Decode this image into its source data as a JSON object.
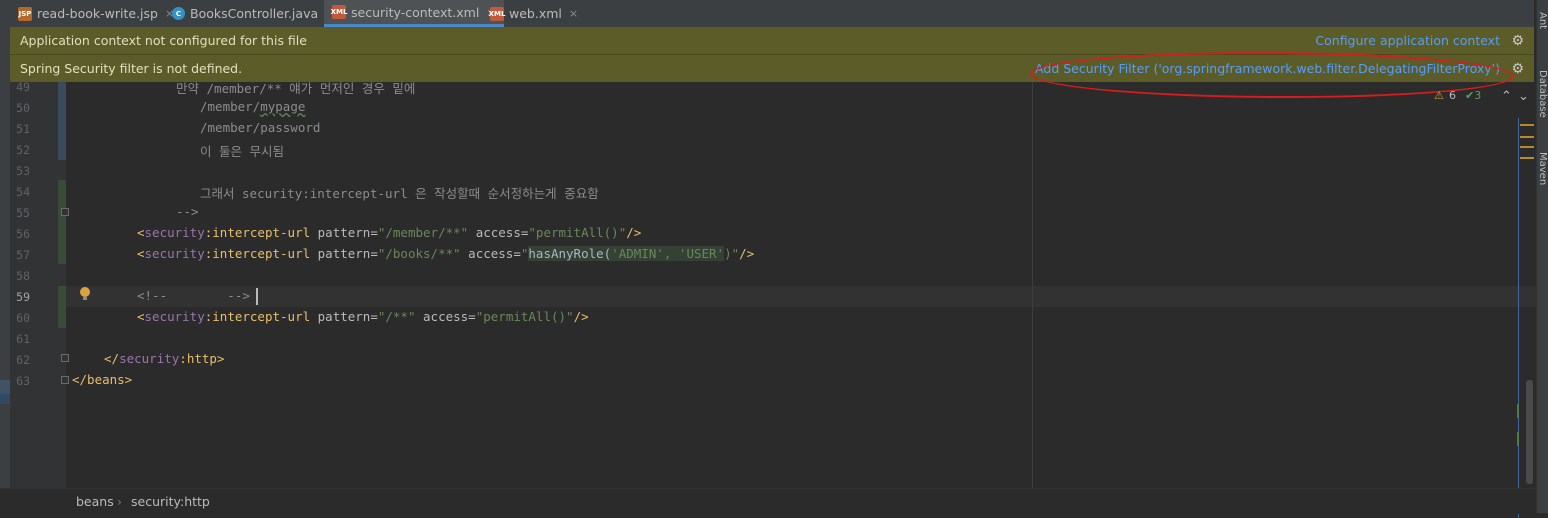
{
  "tabs": [
    {
      "label": "read-book-write.jsp",
      "icon": "jsp-file-icon",
      "icon_text": "JSP",
      "active": false
    },
    {
      "label": "BooksController.java",
      "icon": "java-class-icon",
      "icon_text": "C",
      "active": false
    },
    {
      "label": "security-context.xml",
      "icon": "xml-file-icon",
      "icon_text": "XML",
      "active": true
    },
    {
      "label": "web.xml",
      "icon": "xml-file-icon",
      "icon_text": "XML",
      "active": false
    }
  ],
  "close_glyph": "×",
  "right_tool_labels": [
    "Ant",
    "Database",
    "Maven"
  ],
  "banners": {
    "context": {
      "message": "Application context not configured for this file",
      "action": "Configure application context"
    },
    "security": {
      "message": "Spring Security filter is not defined.",
      "action": "Add Security Filter ('org.springframework.web.filter.DelegatingFilterProxy')"
    }
  },
  "inspections": {
    "warnings": "6",
    "checks": "3",
    "warning_glyph": "⚠",
    "check_glyph": "✔",
    "up": "⌃",
    "down": "⌄"
  },
  "lines": {
    "49": {
      "num": "49",
      "text": "만약 /member/** 얘가 먼저인 경우 밑에"
    },
    "50": {
      "num": "50",
      "text": "/member/",
      "spell": "mypage"
    },
    "51": {
      "num": "51",
      "text": "/member/password"
    },
    "52": {
      "num": "52",
      "text": "이 둘은 무시됨"
    },
    "53": {
      "num": "53"
    },
    "54": {
      "num": "54",
      "text": "그래서 security:intercept-url 은 작성할때 순서정하는게 중요함"
    },
    "55": {
      "num": "55",
      "text": "-->"
    },
    "56": {
      "num": "56",
      "pattern": "\"/member/**\"",
      "access": "\"permitAll()\""
    },
    "57": {
      "num": "57",
      "pattern": "\"/books/**\"",
      "access_q": "\"",
      "access_fn": "hasAnyRole(",
      "access_args": "'ADMIN', 'USER'",
      "access_end": ")\""
    },
    "58": {
      "num": "58"
    },
    "59": {
      "num": "59",
      "text": "<!--        -->"
    },
    "60": {
      "num": "60",
      "pattern": "\"/**\"",
      "access": "\"permitAll()\""
    },
    "61": {
      "num": "61"
    },
    "62": {
      "num": "62",
      "close": "</",
      "ns": "security",
      "colon": ":",
      "tag": "http",
      "end": ">"
    },
    "63": {
      "num": "63",
      "text": "</beans>"
    }
  },
  "syntax": {
    "open": "<",
    "ns": "security",
    "colon": ":",
    "tag": "intercept-url",
    "attr_pattern": " pattern=",
    "attr_access": " access=",
    "selfclose": "/>"
  },
  "breadcrumb": {
    "items": [
      "beans",
      "security:http"
    ],
    "separator": "›"
  },
  "colors": {
    "banner_bg": "#5c5c28",
    "link": "#589df6",
    "tag": "#e8bf6a",
    "value": "#6a8759",
    "annotation_red": "#d61d1d"
  }
}
